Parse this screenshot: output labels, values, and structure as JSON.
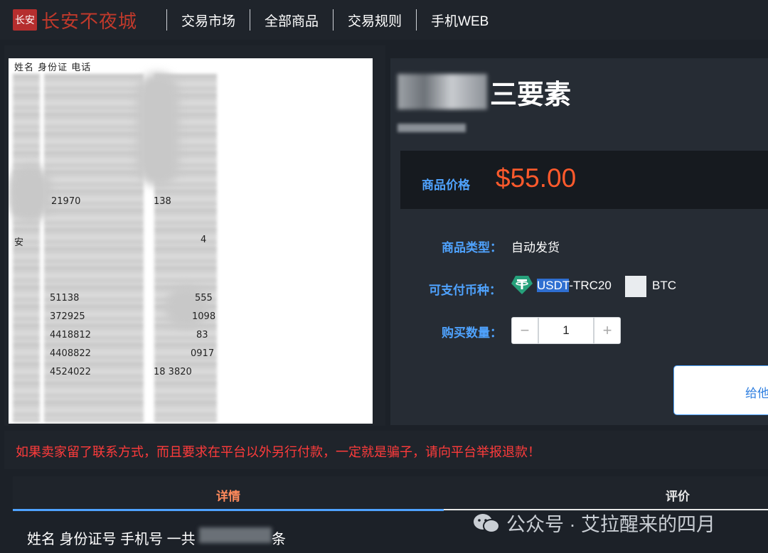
{
  "nav": {
    "logo_mark": "长安",
    "logo_text": "长安不夜城",
    "items": [
      "交易市场",
      "全部商品",
      "交易规则",
      "手机WEB"
    ]
  },
  "preview": {
    "header": "姓名  身份证  电话",
    "rows": [
      {
        "left": "",
        "mid": "21970",
        "right": "138"
      },
      {
        "left": "安",
        "mid": "",
        "right": "4"
      },
      {
        "left": "",
        "mid": "51138",
        "right": "555"
      },
      {
        "left": "",
        "mid": "372925",
        "right": "1098"
      },
      {
        "left": "",
        "mid": "4418812",
        "right": "83"
      },
      {
        "left": "",
        "mid": "4408822",
        "right": "0917"
      },
      {
        "left": "",
        "mid": "4524022",
        "right": "18    3820"
      }
    ]
  },
  "product": {
    "title": "三要素",
    "price_label": "商品价格",
    "price": "$55.00",
    "type_label": "商品类型：",
    "type_value": "自动发货",
    "currency_label": "可支付币种：",
    "currency_usdt_hl": "USDT",
    "currency_usdt_rest": "-TRC20",
    "currency_btc": "BTC",
    "qty_label": "购买数量：",
    "qty_value": "1",
    "qty_minus": "−",
    "qty_plus": "+",
    "buy_button": "给他"
  },
  "warning": "如果卖家留了联系方式，而且要求在平台以外另行付款，一定就是骗子，请向平台举报退款！",
  "tabs": {
    "details": "详情",
    "reviews": "评价"
  },
  "details": {
    "prefix": "姓名 身份证号 手机号 一共",
    "suffix": "条"
  },
  "watermark": "公众号 · 艾拉醒来的四月",
  "colors": {
    "accent": "#4fa3ff",
    "price": "#ff5a2c",
    "warning": "#ff3b3b",
    "usdt": "#26a17b"
  }
}
